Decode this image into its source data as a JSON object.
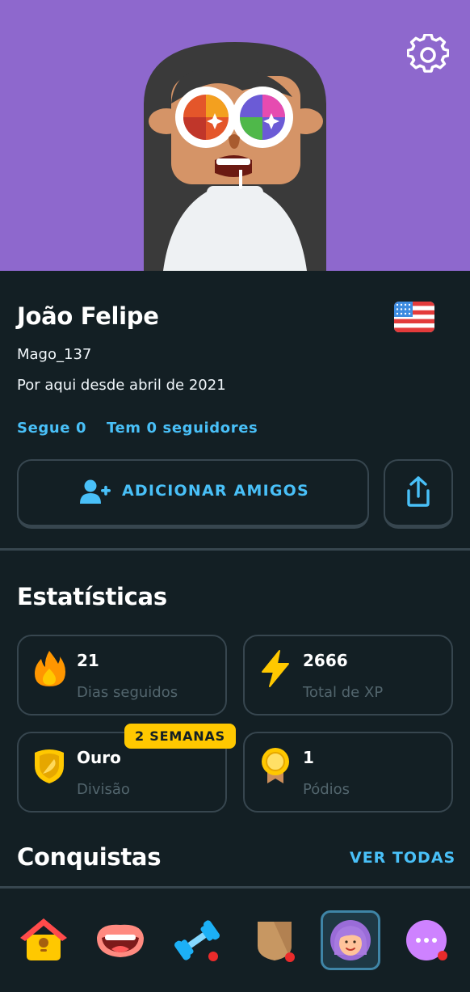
{
  "header": {
    "settings_icon": "gear-icon",
    "background_color": "#8e68cd"
  },
  "profile": {
    "name": "João Felipe",
    "username": "Mago_137",
    "joined": "Por aqui desde abril de 2021",
    "language_flag": "us-flag-icon",
    "following": "Segue 0",
    "followers": "Tem 0 seguidores"
  },
  "actions": {
    "add_friends": "ADICIONAR AMIGOS",
    "add_friends_icon": "add-user-icon",
    "share_icon": "share-icon"
  },
  "stats": {
    "title": "Estatísticas",
    "items": [
      {
        "value": "21",
        "label": "Dias seguidos",
        "icon": "flame-icon"
      },
      {
        "value": "2666",
        "label": "Total de XP",
        "icon": "lightning-icon"
      },
      {
        "value": "Ouro",
        "label": "Divisão",
        "icon": "gold-league-icon",
        "badge": "2 SEMANAS"
      },
      {
        "value": "1",
        "label": "Pódios",
        "icon": "medal-icon"
      }
    ]
  },
  "achievements": {
    "title": "Conquistas",
    "see_all": "VER TODAS"
  },
  "nav": {
    "items": [
      {
        "name": "home",
        "icon": "birdhouse-icon"
      },
      {
        "name": "speak",
        "icon": "mouth-icon"
      },
      {
        "name": "practice",
        "icon": "dumbbell-icon",
        "notification": true
      },
      {
        "name": "leagues",
        "icon": "shield-icon",
        "notification": true
      },
      {
        "name": "profile",
        "icon": "avatar-icon",
        "active": true
      },
      {
        "name": "more",
        "icon": "more-icon",
        "notification": true
      }
    ]
  },
  "colors": {
    "background": "#131f24",
    "border": "#37464f",
    "accent_blue": "#49c0f8",
    "muted": "#52656d",
    "gold": "#ffc800",
    "notification": "#ea2b2b"
  }
}
